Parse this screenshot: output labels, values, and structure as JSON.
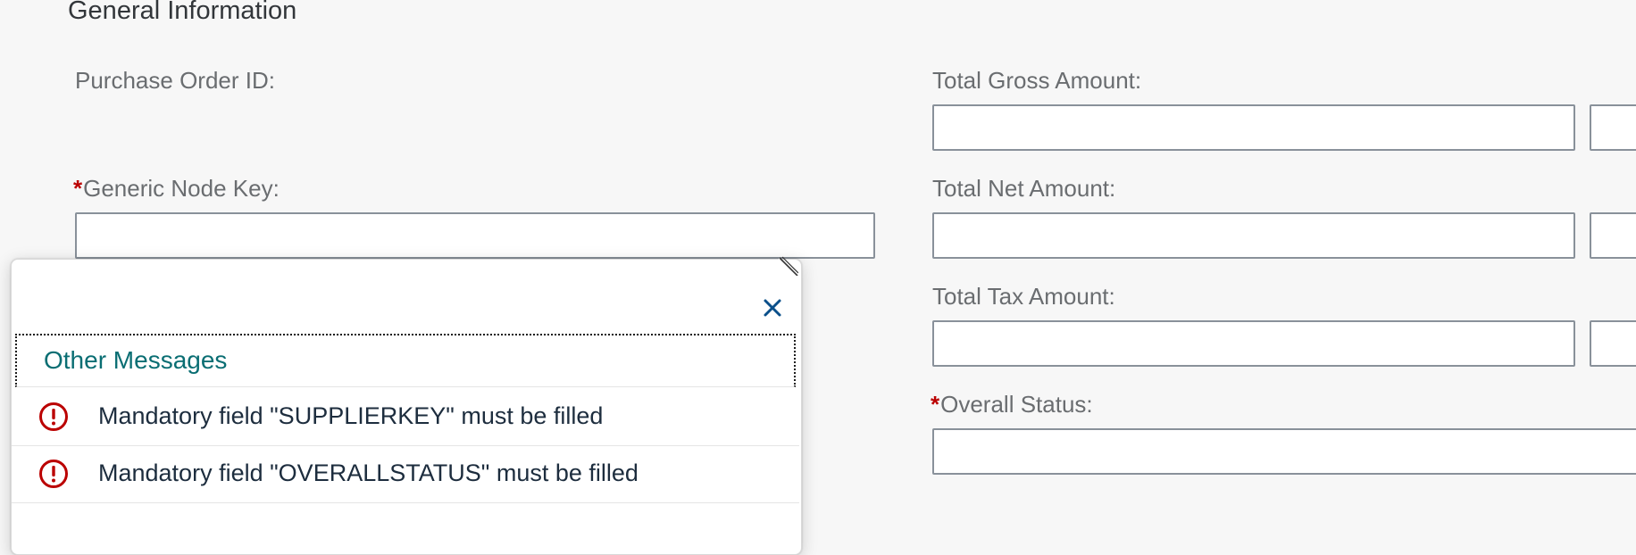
{
  "section": {
    "title": "General Information"
  },
  "left_fields": {
    "purchase_order_id": {
      "label": "Purchase Order ID:"
    },
    "generic_node_key": {
      "label": "Generic Node Key:",
      "required_mark": "*",
      "value": ""
    }
  },
  "right_fields": {
    "total_gross_amount": {
      "label": "Total Gross Amount:",
      "value": ""
    },
    "total_net_amount": {
      "label": "Total Net Amount:",
      "value": ""
    },
    "total_tax_amount": {
      "label": "Total Tax Amount:",
      "value": ""
    },
    "overall_status": {
      "label": "Overall Status:",
      "required_mark": "*",
      "value": ""
    }
  },
  "message_popover": {
    "close_icon": "close-icon",
    "group_title": "Other Messages",
    "messages": [
      {
        "type": "error",
        "icon": "error-icon",
        "text": "Mandatory field \"SUPPLIERKEY\" must be filled"
      },
      {
        "type": "error",
        "icon": "error-icon",
        "text": "Mandatory field \"OVERALLSTATUS\" must be filled"
      }
    ]
  },
  "colors": {
    "background": "#f7f7f7",
    "label": "#6a6d70",
    "required": "#bb0000",
    "group_title": "#0a6e73",
    "error": "#bb0000",
    "close_icon": "#0a4f8a"
  }
}
